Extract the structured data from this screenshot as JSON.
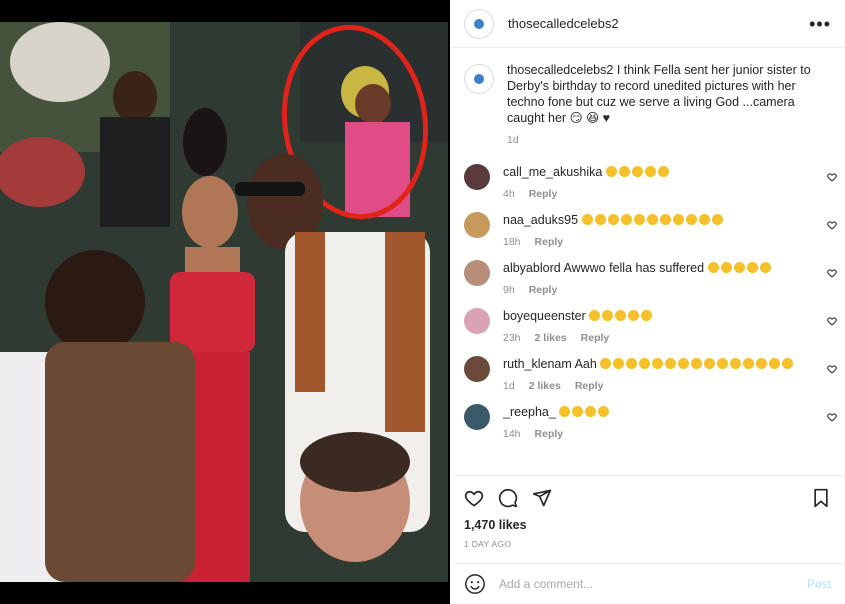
{
  "post": {
    "username": "thosecalledcelebs2",
    "caption": "I think Fella sent her junior sister to Derby's birthday to record unedited pictures with her techno fone but cuz we serve a living God ...camera caught her",
    "caption_emoji": "😏 😆 ♥",
    "caption_age": "1d",
    "likes": "1,470 likes",
    "time_ago": "1 DAY AGO",
    "add_comment_placeholder": "Add a comment...",
    "post_label": "Post",
    "more_icon": "more-horizontal-icon"
  },
  "comments": [
    {
      "username": "call_me_akushika",
      "text": "",
      "emoji_count": 5,
      "age": "4h",
      "likes": "",
      "reply": "Reply",
      "avatar_color": "#5a3a3a"
    },
    {
      "username": "naa_aduks95",
      "text": "",
      "emoji_count": 11,
      "age": "18h",
      "likes": "",
      "reply": "Reply",
      "avatar_color": "#c59a5a"
    },
    {
      "username": "albyablord",
      "text": "Awwwo fella has suffered",
      "emoji_count": 5,
      "age": "9h",
      "likes": "",
      "reply": "Reply",
      "avatar_color": "#b88e78"
    },
    {
      "username": "boyequeenster",
      "text": "",
      "emoji_count": 5,
      "age": "23h",
      "likes": "2 likes",
      "reply": "Reply",
      "avatar_color": "#d9a3b3"
    },
    {
      "username": "ruth_klenam",
      "text": "Aah",
      "emoji_count": 15,
      "age": "1d",
      "likes": "2 likes",
      "reply": "Reply",
      "avatar_color": "#6b4a3a"
    },
    {
      "username": "_reepha_",
      "text": "",
      "emoji_count": 4,
      "age": "14h",
      "likes": "",
      "reply": "Reply",
      "avatar_color": "#3a5a6a"
    }
  ],
  "colors": {
    "accent_blue": "#0095f6",
    "post_disabled": "#b2dffc",
    "meta_gray": "#8e8e8e",
    "annotation_red": "#e0241c"
  }
}
